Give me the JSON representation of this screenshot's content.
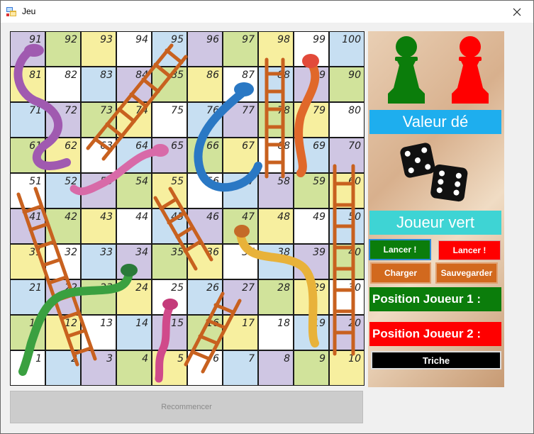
{
  "window": {
    "title": "Jeu"
  },
  "board": {
    "rows": [
      [
        91,
        92,
        93,
        94,
        95,
        96,
        97,
        98,
        99,
        100
      ],
      [
        81,
        82,
        83,
        84,
        85,
        86,
        87,
        88,
        89,
        90
      ],
      [
        71,
        72,
        73,
        74,
        75,
        76,
        77,
        78,
        79,
        80
      ],
      [
        61,
        62,
        63,
        64,
        65,
        66,
        67,
        68,
        69,
        70
      ],
      [
        51,
        52,
        53,
        54,
        55,
        56,
        57,
        58,
        59,
        60
      ],
      [
        41,
        42,
        43,
        44,
        45,
        46,
        47,
        48,
        49,
        50
      ],
      [
        31,
        32,
        33,
        34,
        35,
        36,
        37,
        38,
        39,
        40
      ],
      [
        21,
        22,
        23,
        24,
        25,
        26,
        27,
        28,
        29,
        30
      ],
      [
        11,
        12,
        13,
        14,
        15,
        16,
        17,
        18,
        19,
        20
      ],
      [
        1,
        2,
        3,
        4,
        5,
        6,
        7,
        8,
        9,
        10
      ]
    ],
    "colors": {
      "lavender": "#cfc6e3",
      "green": "#d1e39b",
      "yellow": "#f7ef9f",
      "white": "#ffffff",
      "blue": "#c7dff2"
    }
  },
  "side": {
    "pawn_green_color": "#0b7d0b",
    "pawn_red_color": "#ff0000",
    "dice_label": "Valeur dé",
    "current_player_label": "Joueur vert",
    "roll_green_label": "Lancer !",
    "roll_red_label": "Lancer !",
    "load_label": "Charger",
    "save_label": "Sauvegarder",
    "position_player1_label": "Position Joueur 1 :",
    "position_player2_label": "Position Joueur 2 :",
    "cheat_label": "Triche"
  },
  "footer": {
    "restart_label": "Recommencer"
  }
}
